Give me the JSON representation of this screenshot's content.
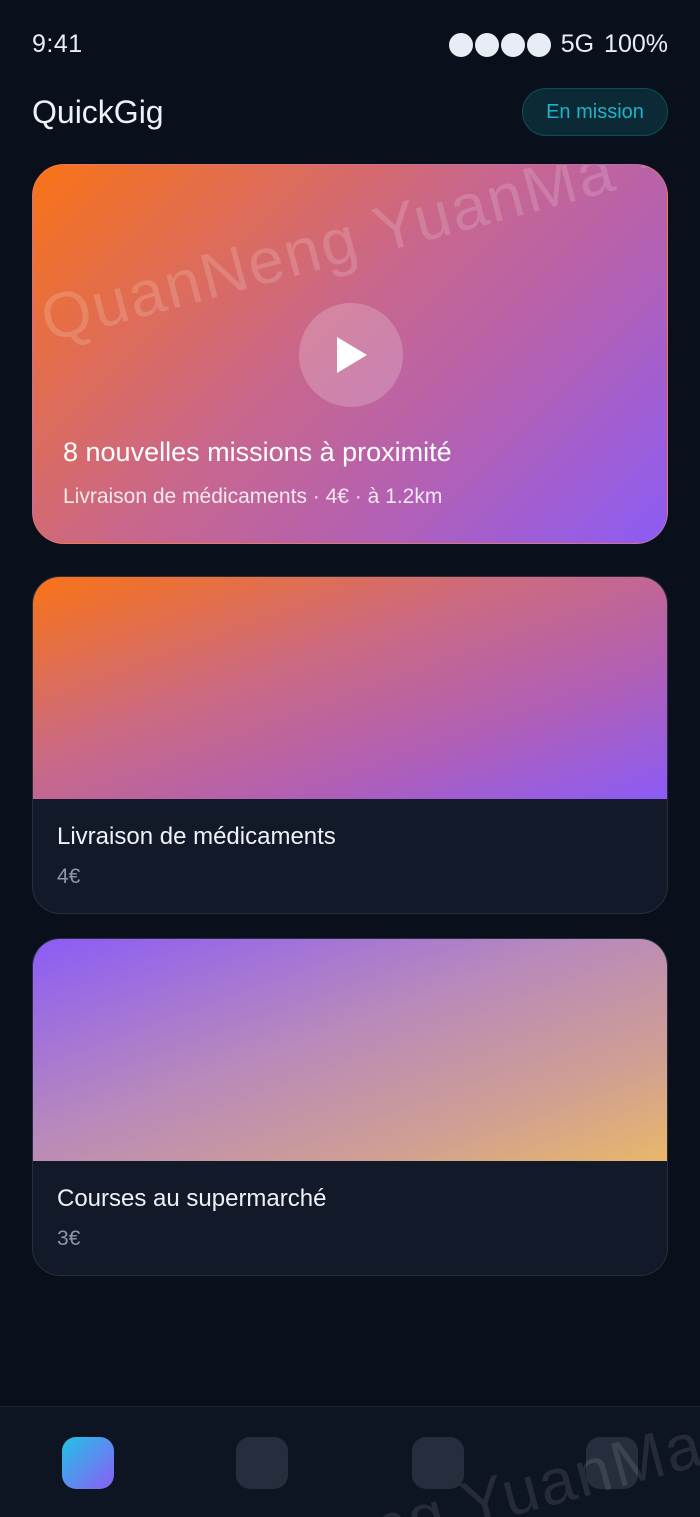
{
  "status_bar": {
    "time": "9:41",
    "network": "5G",
    "battery": "100%"
  },
  "header": {
    "app_title": "QuickGig",
    "badge_label": "En mission"
  },
  "hero": {
    "title": "8 nouvelles missions à proximité",
    "subtitle": "Livraison de médicaments · 4€ · à 1.2km",
    "watermark": "QuanNeng YuanMa · in"
  },
  "gigs": [
    {
      "title": "Livraison de médicaments",
      "price": "4€"
    },
    {
      "title": "Courses au supermarché",
      "price": "3€"
    }
  ],
  "nav": {
    "items": [
      {
        "icon": "home-icon",
        "active": true
      },
      {
        "icon": "tab-2-icon",
        "active": false
      },
      {
        "icon": "tab-3-icon",
        "active": false
      },
      {
        "icon": "tab-4-icon",
        "active": false
      }
    ],
    "watermark": "Neng YuanMa"
  },
  "colors": {
    "background": "#0a101b",
    "accent_cyan": "#22c3e6",
    "accent_purple": "#8b5cf6",
    "accent_orange": "#f97316"
  }
}
